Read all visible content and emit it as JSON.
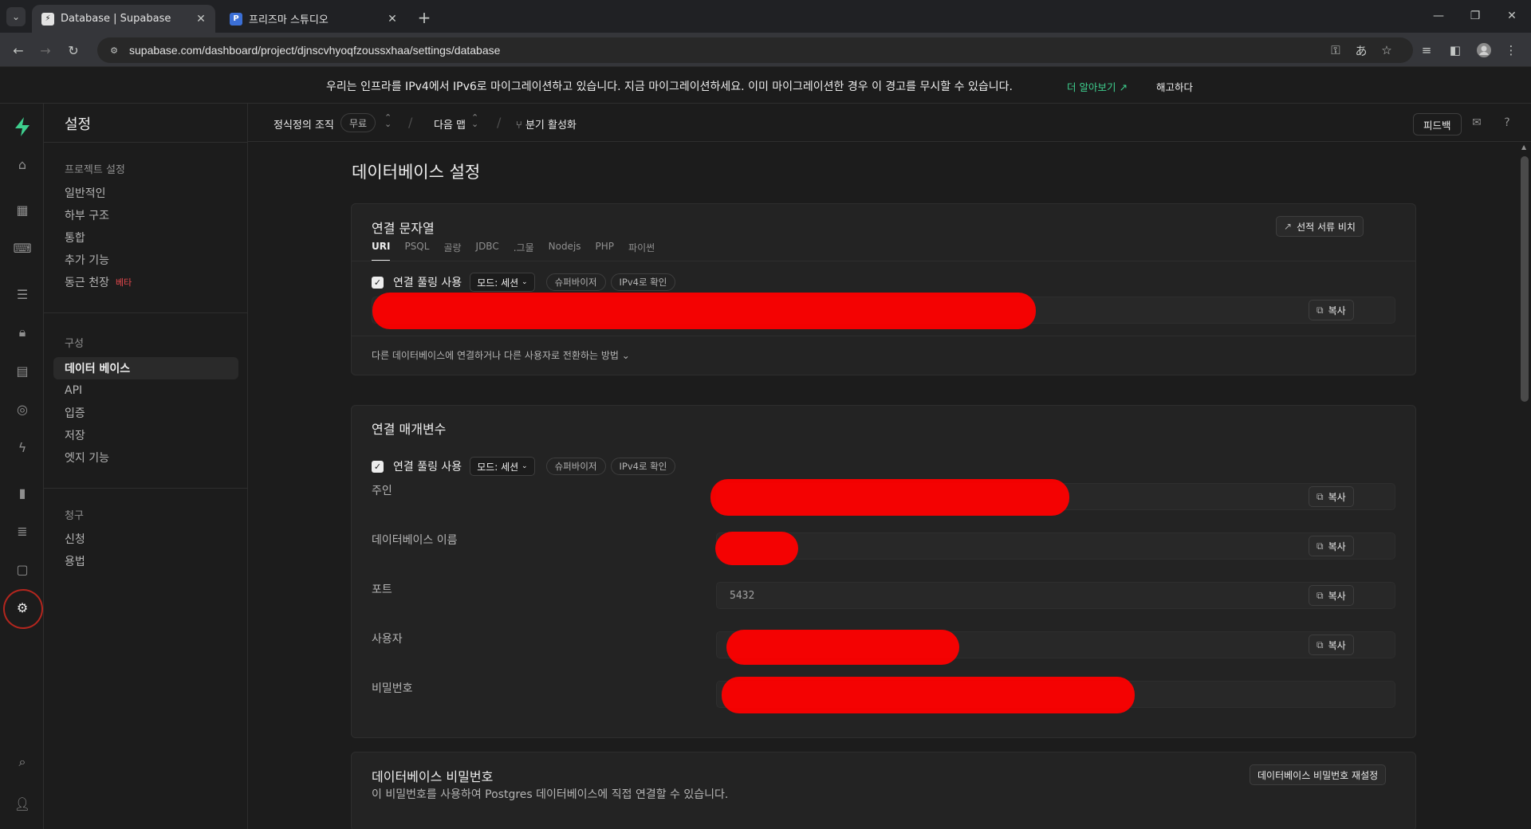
{
  "browser": {
    "tabs": [
      {
        "title": "Database | Supabase",
        "active": true
      },
      {
        "title": "프리즈마 스튜디오",
        "active": false
      }
    ],
    "url": "supabase.com/dashboard/project/djnscvhyoqfzoussxhaa/settings/database"
  },
  "banner": {
    "message": "우리는 인프라를 IPv4에서 IPv6로 마이그레이션하고 있습니다. 지금 마이그레이션하세요. 이미 마이그레이션한 경우 이 경고를 무시할 수 있습니다.",
    "learn_more": "더 알아보기",
    "dismiss": "해고하다"
  },
  "sidebar": {
    "title": "설정",
    "sections": [
      {
        "label": "프로젝트 설정",
        "items": [
          {
            "label": "일반적인"
          },
          {
            "label": "하부 구조"
          },
          {
            "label": "통합"
          },
          {
            "label": "추가 기능"
          },
          {
            "label": "동근 천장",
            "badge": "베타"
          }
        ]
      },
      {
        "label": "구성",
        "items": [
          {
            "label": "데이터 베이스",
            "active": true
          },
          {
            "label": "API"
          },
          {
            "label": "입증"
          },
          {
            "label": "저장"
          },
          {
            "label": "엣지 기능"
          }
        ]
      },
      {
        "label": "청구",
        "items": [
          {
            "label": "신청"
          },
          {
            "label": "용법"
          }
        ]
      }
    ]
  },
  "topbar": {
    "org": "정식정의 조직",
    "plan": "무료",
    "project": "다음 맵",
    "branch": "분기 활성화",
    "feedback": "피드백"
  },
  "page": {
    "title": "데이터베이스 설정",
    "connection_string": {
      "title": "연결 문자열",
      "docs_button": "선적 서류 비치",
      "tabs": [
        "URI",
        "PSQL",
        "골랑",
        "JDBC",
        ".그물",
        "Nodejs",
        "PHP",
        "파이썬"
      ],
      "active_tab": "URI",
      "pooling_label": "연결 풀링 사용",
      "mode": "모드: 세션",
      "tags": [
        "슈퍼바이저",
        "IPv4로 확인"
      ],
      "copy": "복사",
      "hint": "다른 데이터베이스에 연결하거나 다른 사용자로 전환하는 방법"
    },
    "connection_params": {
      "title": "연결 매개변수",
      "pooling_label": "연결 풀링 사용",
      "mode": "모드: 세션",
      "tags": [
        "슈퍼바이저",
        "IPv4로 확인"
      ],
      "copy": "복사",
      "rows": [
        {
          "label": "주인",
          "value": ""
        },
        {
          "label": "데이터베이스 이름",
          "value": ""
        },
        {
          "label": "포트",
          "value": "5432"
        },
        {
          "label": "사용자",
          "value": ""
        },
        {
          "label": "비밀번호",
          "value": ""
        }
      ]
    },
    "db_password": {
      "title": "데이터베이스 비밀번호",
      "description": "이 비밀번호를 사용하여 Postgres 데이터베이스에 직접 연결할 수 있습니다.",
      "reset_button": "데이터베이스 비밀번호 재설정"
    }
  },
  "colors": {
    "background": "#1c1c1c",
    "card": "#232323",
    "accent": "#3ecf8e",
    "beta": "#e5484d",
    "redaction": "#ff0000"
  }
}
